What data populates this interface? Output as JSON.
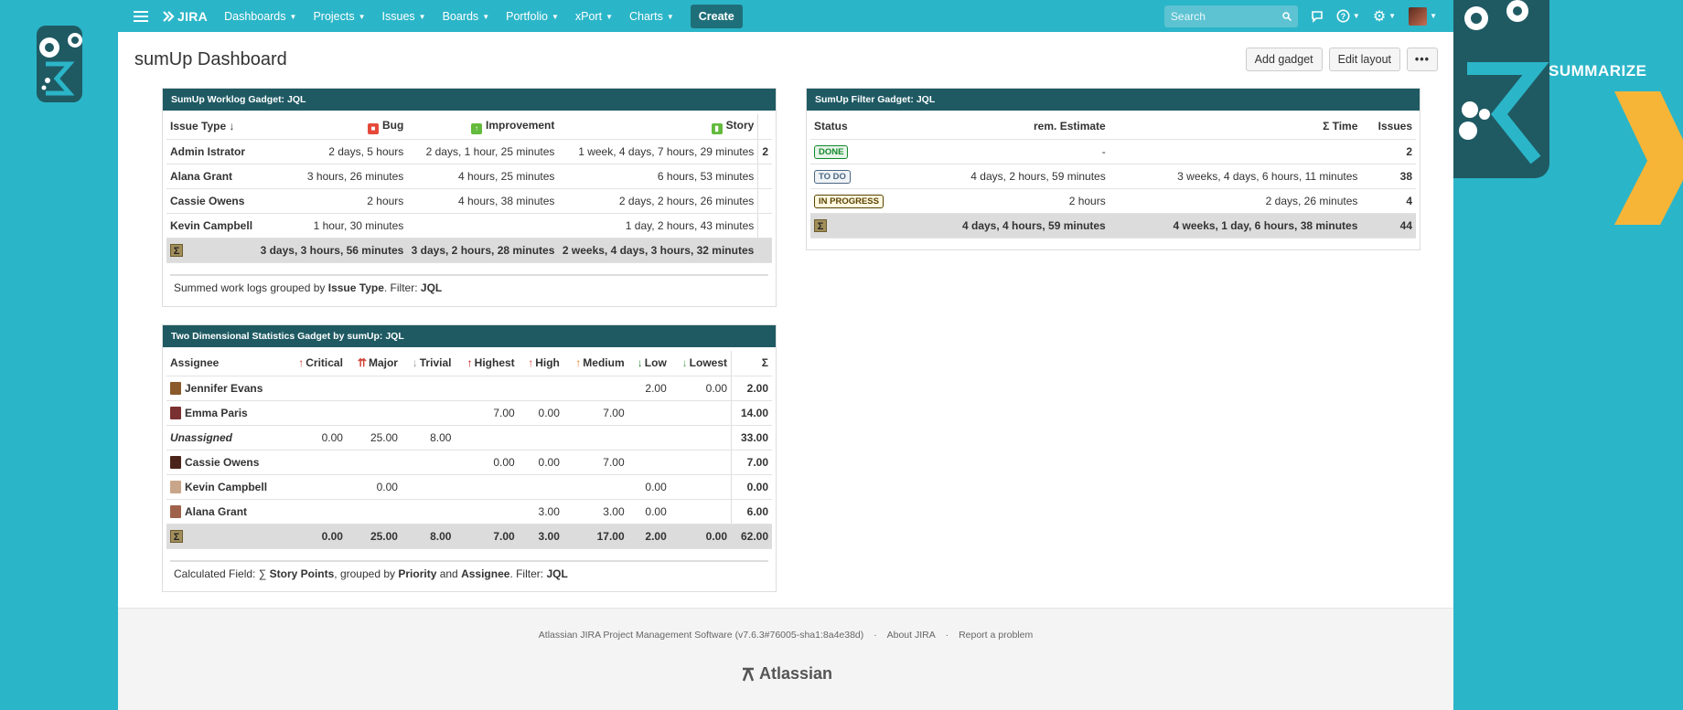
{
  "brand": {
    "logo": "JIRA",
    "summarize": "SUMMARIZE"
  },
  "nav": {
    "items": [
      "Dashboards",
      "Projects",
      "Issues",
      "Boards",
      "Portfolio",
      "xPort",
      "Charts"
    ],
    "create": "Create",
    "search_placeholder": "Search"
  },
  "page": {
    "title": "sumUp Dashboard",
    "add_gadget": "Add gadget",
    "edit_layout": "Edit layout",
    "more": "•••"
  },
  "worklog": {
    "title": "SumUp Worklog Gadget: JQL",
    "headers": [
      "Issue Type",
      "Bug",
      "Improvement",
      "Story"
    ],
    "rows": [
      {
        "name": "Admin Istrator",
        "vals": [
          "2 days, 5 hours",
          "2 days, 1 hour, 25 minutes",
          "1 week, 4 days, 7 hours, 29 minutes"
        ],
        "extra": "2"
      },
      {
        "name": "Alana Grant",
        "vals": [
          "3 hours, 26 minutes",
          "4 hours, 25 minutes",
          "6 hours, 53 minutes"
        ],
        "extra": ""
      },
      {
        "name": "Cassie Owens",
        "vals": [
          "2 hours",
          "4 hours, 38 minutes",
          "2 days, 2 hours, 26 minutes"
        ],
        "extra": ""
      },
      {
        "name": "Kevin Campbell",
        "vals": [
          "1 hour, 30 minutes",
          "",
          "1 day, 2 hours, 43 minutes"
        ],
        "extra": ""
      }
    ],
    "sum": [
      "3 days, 3 hours, 56 minutes",
      "3 days, 2 hours, 28 minutes",
      "2 weeks, 4 days, 3 hours, 32 minutes"
    ],
    "footnote_pre": "Summed work logs grouped by ",
    "footnote_b1": "Issue Type",
    "footnote_mid": ". Filter: ",
    "footnote_b2": "JQL"
  },
  "filter": {
    "title": "SumUp Filter Gadget: JQL",
    "headers": [
      "Status",
      "rem. Estimate",
      "Σ Time",
      "Issues"
    ],
    "rows": [
      {
        "status": "DONE",
        "color": "#14892c",
        "est": "-",
        "time": "",
        "issues": "2"
      },
      {
        "status": "TO DO",
        "color": "#4a6785",
        "est": "4 days, 2 hours, 59 minutes",
        "time": "3 weeks, 4 days, 6 hours, 11 minutes",
        "issues": "38"
      },
      {
        "status": "IN PROGRESS",
        "color": "#594300",
        "est": "2 hours",
        "time": "2 days, 26 minutes",
        "issues": "4"
      }
    ],
    "sum": {
      "est": "4 days, 4 hours, 59 minutes",
      "time": "4 weeks, 1 day, 6 hours, 38 minutes",
      "issues": "44"
    }
  },
  "twod": {
    "title": "Two Dimensional Statistics Gadget by sumUp: JQL",
    "headers": [
      "Assignee",
      "Critical",
      "Major",
      "Trivial",
      "Highest",
      "High",
      "Medium",
      "Low",
      "Lowest",
      "Σ"
    ],
    "rows": [
      {
        "name": "Jennifer Evans",
        "vals": [
          "",
          "",
          "",
          "",
          "",
          "",
          "2.00",
          "0.00"
        ],
        "sum": "2.00"
      },
      {
        "name": "Emma Paris",
        "vals": [
          "",
          "",
          "",
          "7.00",
          "0.00",
          "7.00",
          "",
          ""
        ],
        "sum": "14.00"
      },
      {
        "name": "Unassigned",
        "vals": [
          "0.00",
          "25.00",
          "8.00",
          "",
          "",
          "",
          "",
          ""
        ],
        "sum": "33.00"
      },
      {
        "name": "Cassie Owens",
        "vals": [
          "",
          "",
          "",
          "0.00",
          "0.00",
          "7.00",
          "",
          ""
        ],
        "sum": "7.00"
      },
      {
        "name": "Kevin Campbell",
        "vals": [
          "",
          "0.00",
          "",
          "",
          "",
          "",
          "0.00",
          ""
        ],
        "sum": "0.00"
      },
      {
        "name": "Alana Grant",
        "vals": [
          "",
          "",
          "",
          "",
          "3.00",
          "3.00",
          "0.00",
          ""
        ],
        "sum": "6.00"
      }
    ],
    "sum": [
      "0.00",
      "25.00",
      "8.00",
      "7.00",
      "3.00",
      "17.00",
      "2.00",
      "0.00",
      "62.00"
    ],
    "footnote_pre": "Calculated Field: ∑ ",
    "footnote_b1": "Story Points",
    "footnote_mid1": ", grouped by ",
    "footnote_b2": "Priority",
    "footnote_mid2": " and ",
    "footnote_b3": "Assignee",
    "footnote_mid3": ". Filter: ",
    "footnote_b4": "JQL"
  },
  "footer": {
    "software": "Atlassian JIRA Project Management Software (v7.6.3#76005-sha1:8a4e38d)",
    "about": "About JIRA",
    "report": "Report a problem",
    "atlassian": "Atlassian"
  }
}
